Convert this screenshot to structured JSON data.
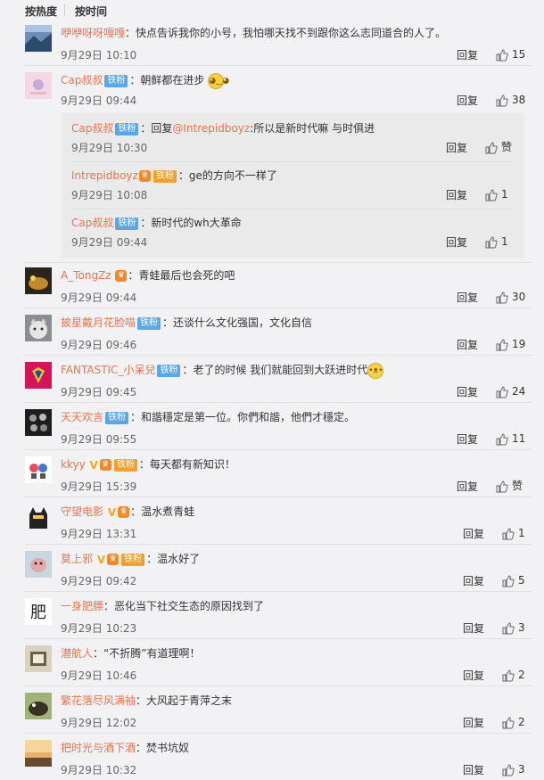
{
  "sort": {
    "hot": "按热度",
    "time": "按时间"
  },
  "reply_label": "回复",
  "comments": [
    {
      "user": "咿咿呀呀嘎嘎",
      "text": "：快点告诉我你的小号，我怕哪天找不到跟你这么志同道合的人了。",
      "time": "9月29日 10:10",
      "likes": "15"
    },
    {
      "user": "Cap叔叔",
      "badge": "铁粉",
      "text": "：朝鲜都在进步",
      "time": "9月29日 09:44",
      "likes": "38"
    },
    {
      "user": "A_TongZz",
      "text": "：青蛙最后也会死的吧",
      "time": "9月29日 09:44",
      "likes": "30"
    },
    {
      "user": "披星戴月花脸喵",
      "badge": "铁粉",
      "text": "：还谈什么文化强国，文化自信",
      "time": "9月29日 09:46",
      "likes": "19"
    },
    {
      "user": "FANTASTIC_小呆兒",
      "badge": "铁粉",
      "text": "：老了的时候 我们就能回到大跃进时代",
      "time": "9月29日 09:45",
      "likes": "24"
    },
    {
      "user": "天天欢言",
      "badge": "铁粉",
      "text": "：和諧穩定是第一位。你們和諧，他們才穩定。",
      "time": "9月29日 09:55",
      "likes": "11"
    },
    {
      "user": "kkyy",
      "badge": "铁粉",
      "text": "：每天都有新知识！",
      "time": "9月29日 15:39",
      "likes": "赞"
    },
    {
      "user": "守望电影",
      "text": "：温水煮青蛙",
      "time": "9月29日 13:31",
      "likes": "1"
    },
    {
      "user": "莫上邪",
      "badge": "铁粉",
      "text": "：温水好了",
      "time": "9月29日 09:42",
      "likes": "5"
    },
    {
      "user": "一身肥膘",
      "text": "：恶化当下社交生态的原因找到了",
      "time": "9月29日 10:23",
      "likes": "3"
    },
    {
      "user": "潜航人",
      "text": "：“不折腾”有道理啊！",
      "time": "9月29日 10:46",
      "likes": "2"
    },
    {
      "user": "繁花落尽风满袖",
      "text": "：大风起于青萍之末",
      "time": "9月29日 12:02",
      "likes": "2"
    },
    {
      "user": "把时光与酒下酒",
      "text": "：焚书坑奴",
      "time": "9月29日 10:32",
      "likes": "3"
    }
  ],
  "replies": [
    {
      "user": "Cap叔叔",
      "badge": "铁粉",
      "text": "：回复",
      "mention": "@Intrepidboyz",
      "text2": ":所以是新时代嘛 与时俱进",
      "time": "9月29日 10:30",
      "likes": "赞"
    },
    {
      "user": "Intrepidboyz",
      "badge": "铁粉",
      "text": "：ge的方向不一样了",
      "time": "9月29日 10:08",
      "likes": "1"
    },
    {
      "user": "Cap叔叔",
      "badge": "铁粉",
      "text": "：新时代的wh大革命",
      "time": "9月29日 09:44",
      "likes": "1"
    }
  ],
  "colors": {
    "username": "#eb7350",
    "badge": "#5aa7e8",
    "background": "#f2f2f5"
  }
}
